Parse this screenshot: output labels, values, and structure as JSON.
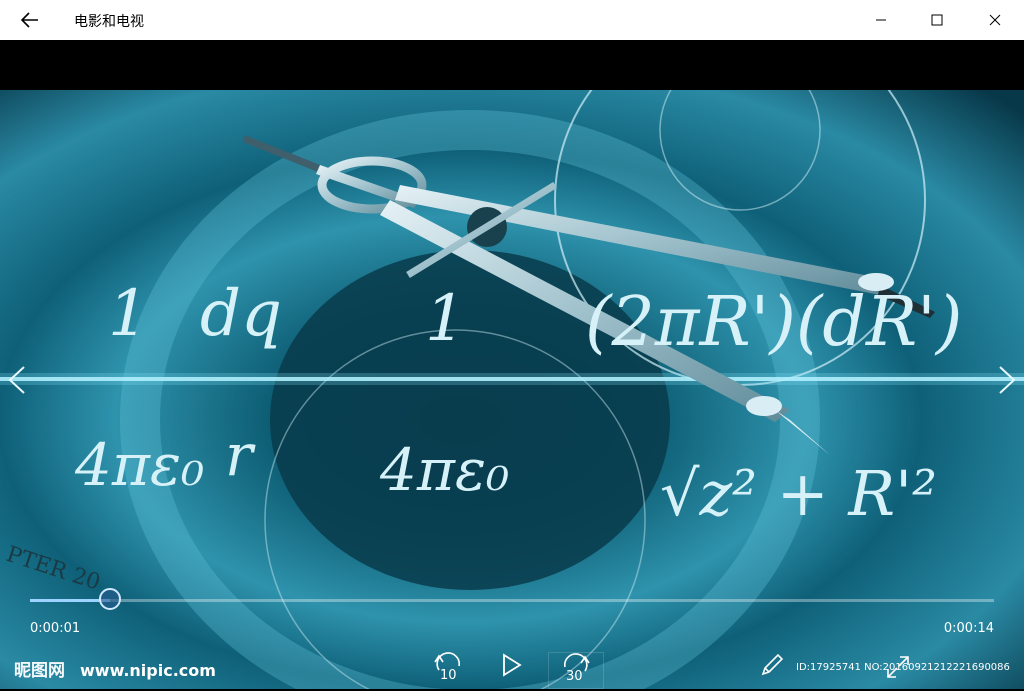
{
  "window": {
    "title": "电影和电视"
  },
  "player": {
    "current_time": "0:00:01",
    "total_time": "0:00:14",
    "progress": 0.083,
    "skip_back_label": "10",
    "skip_forward_label": "30"
  },
  "video_overlay": {
    "eq1_num": "1",
    "eq1_num2": "dq",
    "eq1_den": "4πε₀",
    "eq1_den2": "r",
    "eq2_num": "1",
    "eq2_den": "4πε₀",
    "eq3_top": "(2πR')(dR')",
    "eq3_bottom": "√z² + R'²",
    "chapter": "PTER 20"
  },
  "watermark": {
    "brand": "昵图网",
    "url": "www.nipic.com",
    "id": "ID:17925741 NO:20160921212221690086"
  },
  "colors": {
    "accent": "#9fd3ff",
    "video_base": "#0e5a6e"
  },
  "icons": {
    "back": "back-arrow-icon",
    "minimize": "minimize-icon",
    "maximize": "maximize-icon",
    "close": "close-icon",
    "play": "play-icon",
    "pen": "pen-icon",
    "expand": "expand-icon"
  }
}
